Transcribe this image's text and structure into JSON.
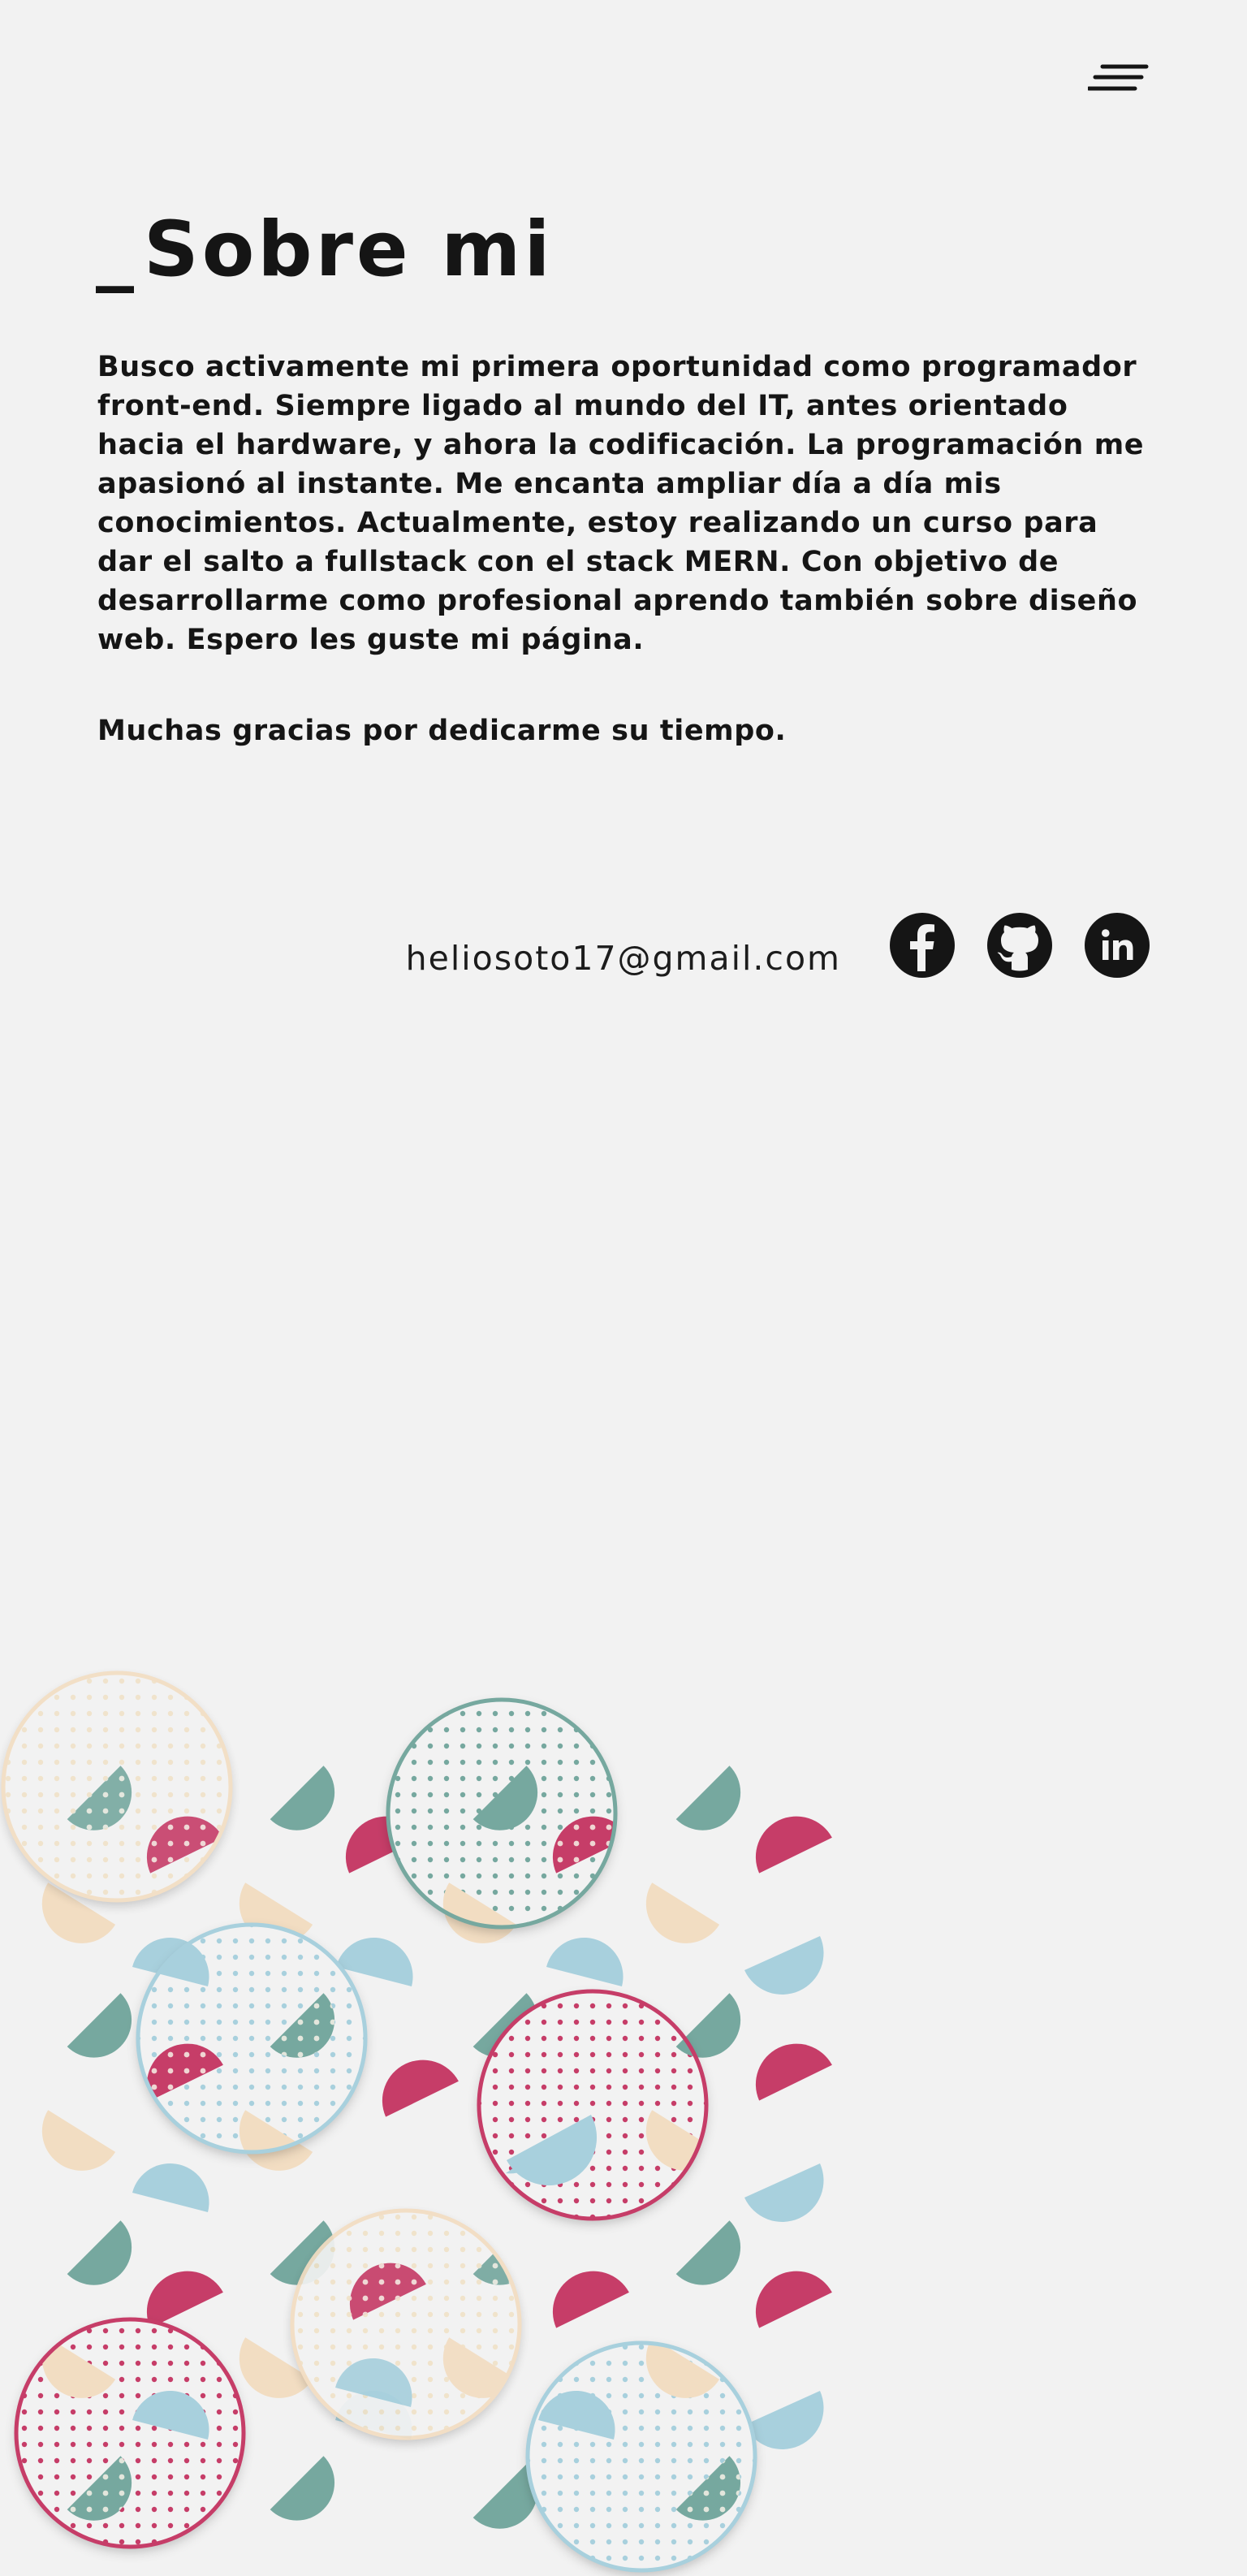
{
  "header": {
    "menu_icon": "hamburger-menu-icon"
  },
  "about": {
    "title_prefix": "_",
    "title": "Sobre mi",
    "paragraph": "Busco activamente mi primera oportunidad como programador front-end. Siempre ligado al mundo del IT, antes orientado hacia el hardware, y ahora la codificación. La programación me apasionó al instante. Me encanta ampliar día a día mis conocimientos. Actualmente, estoy realizando un curso para dar el salto a fullstack con el stack MERN. Con objetivo de desarrollarme como profesional aprendo también sobre diseño web. Espero les guste mi página.",
    "thanks": "Muchas gracias por dedicarme su tiempo."
  },
  "contact": {
    "email": "heliosoto17@gmail.com",
    "social": [
      {
        "icon": "facebook-icon"
      },
      {
        "icon": "github-icon"
      },
      {
        "icon": "linkedin-icon"
      }
    ]
  },
  "colors": {
    "background": "#f2f2f2",
    "text": "#151515",
    "teal": "#76a89f",
    "crimson": "#c63d68",
    "light_blue": "#a8d0dd",
    "peach": "#f2ddc2"
  }
}
